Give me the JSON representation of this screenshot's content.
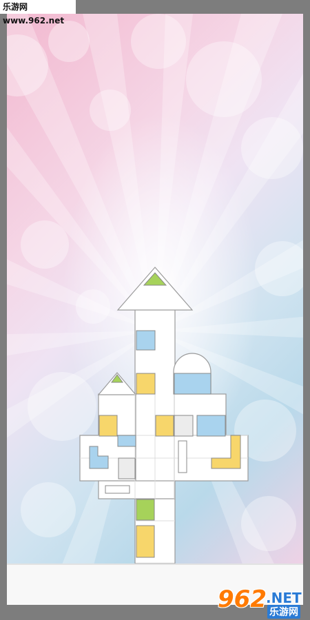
{
  "watermark_top": "乐游网 www.962.net",
  "watermark_bottom": {
    "number": "962",
    "suffix": ".NET",
    "cn": "乐游网"
  },
  "colors": {
    "block_white": "#ffffff",
    "block_blue": "#a9d3ee",
    "block_yellow": "#f7d66b",
    "block_green": "#a6d25a",
    "block_gray": "#ececec",
    "outline": "#9a9a9a"
  }
}
